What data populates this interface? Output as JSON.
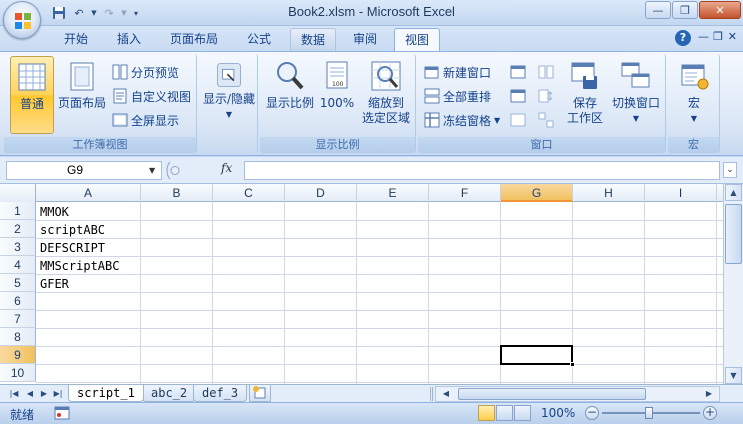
{
  "window": {
    "title": "Book2.xlsm - Microsoft Excel"
  },
  "ribbon_tabs": [
    "开始",
    "插入",
    "页面布局",
    "公式",
    "数据",
    "审阅",
    "视图"
  ],
  "active_tab": "视图",
  "ribbon": {
    "workbook_views": {
      "label": "工作簿视图",
      "normal": "普通",
      "page_layout": "页面布局",
      "page_break_preview": "分页预览",
      "custom_views": "自定义视图",
      "full_screen": "全屏显示"
    },
    "show_hide": {
      "label": "显示/隐藏"
    },
    "zoom": {
      "label": "显示比例",
      "zoom": "显示比例",
      "hundred": "100%",
      "zoom_to_selection_line1": "缩放到",
      "zoom_to_selection_line2": "选定区域"
    },
    "window": {
      "label": "窗口",
      "new_window": "新建窗口",
      "arrange_all": "全部重排",
      "freeze_panes": "冻结窗格",
      "save_line1": "保存",
      "save_line2": "工作区",
      "switch_windows": "切换窗口"
    },
    "macros": {
      "label": "宏",
      "macros": "宏"
    }
  },
  "formula_bar": {
    "name_box": "G9",
    "fx": "fx",
    "formula": ""
  },
  "grid": {
    "columns": [
      "A",
      "B",
      "C",
      "D",
      "E",
      "F",
      "G",
      "H",
      "I"
    ],
    "rows": [
      "1",
      "2",
      "3",
      "4",
      "5",
      "6",
      "7",
      "8",
      "9",
      "10"
    ],
    "selected_column": "G",
    "selected_row": "9",
    "cells_col_a": [
      "MMOK",
      "scriptABC",
      "DEFSCRIPT",
      "MMScriptABC",
      "GFER"
    ]
  },
  "sheet_tabs": [
    "script_1",
    "abc_2",
    "def_3"
  ],
  "active_sheet": "script_1",
  "status": {
    "ready": "就绪",
    "zoom": "100%"
  }
}
